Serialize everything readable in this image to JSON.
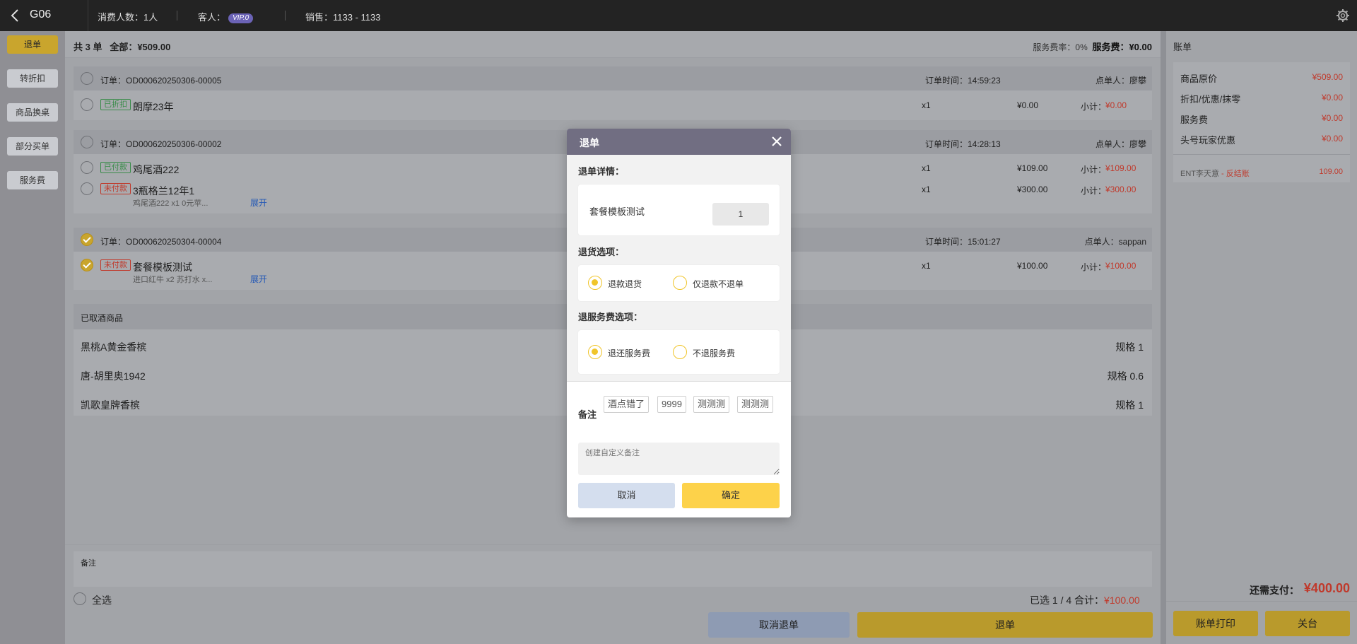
{
  "topbar": {
    "table_no": "G06",
    "consumers": "消费人数：1人",
    "guest_label": "客人：",
    "vip": "VIP.0",
    "sales": "销售：1133 - 1133"
  },
  "sidebar": {
    "items": [
      {
        "label": "退单"
      },
      {
        "label": "转折扣"
      },
      {
        "label": "商品换桌"
      },
      {
        "label": "部分买单"
      },
      {
        "label": "服务费"
      }
    ]
  },
  "summary": {
    "count": "共 3 单",
    "total_label": "全部：",
    "total": "¥509.00",
    "service_rate": "服务费率：0%",
    "service_fee_label": "服务费：",
    "service_fee": "¥0.00"
  },
  "orders": [
    {
      "id": "订单：OD000620250306-00005",
      "time": "订单时间：14:59:23",
      "waiter": "点单人：廖攀",
      "items": [
        {
          "tag": "已折扣",
          "name": "朗摩23年",
          "qty": "x1",
          "price": "¥0.00",
          "subtotal_label": "小计：",
          "subtotal": "¥0.00"
        }
      ]
    },
    {
      "id": "订单：OD000620250306-00002",
      "time": "订单时间：14:28:13",
      "waiter": "点单人：廖攀",
      "items": [
        {
          "tag": "已付款",
          "name": "鸡尾酒222",
          "qty": "x1",
          "price": "¥109.00",
          "subtotal_label": "小计：",
          "subtotal": "¥109.00"
        },
        {
          "tag": "未付款",
          "name": "3瓶格兰12年1",
          "sub": "鸡尾酒222 x1   0元苹...",
          "expand": "展开",
          "qty": "x1",
          "price": "¥300.00",
          "subtotal_label": "小计：",
          "subtotal": "¥300.00"
        }
      ]
    },
    {
      "id": "订单：OD000620250304-00004",
      "time": "订单时间：15:01:27",
      "waiter": "点单人：sappan",
      "items": [
        {
          "tag": "未付款",
          "name": "套餐模板测试",
          "sub": "进口红牛 x2   苏打水 x...",
          "expand": "展开",
          "qty": "x1",
          "price": "¥100.00",
          "subtotal_label": "小计：",
          "subtotal": "¥100.00"
        }
      ]
    }
  ],
  "cancelled": {
    "title": "已取酒商品",
    "items": [
      {
        "name": "黑桃A黄金香槟",
        "spec": "规格 1"
      },
      {
        "name": "唐-胡里奥1942",
        "spec": "规格 0.6"
      },
      {
        "name": "凯歌皇牌香槟",
        "spec": "规格 1"
      }
    ]
  },
  "bottom": {
    "remark_label": "备注",
    "select_all": "全选",
    "selected": "已选 1 / 4 合计：",
    "selected_total": "¥100.00",
    "cancel_refund": "取消退单",
    "refund": "退单"
  },
  "bill": {
    "title": "账单",
    "rows": [
      {
        "label": "商品原价",
        "value": "¥509.00"
      },
      {
        "label": "折扣/优惠/抹零",
        "value": "¥0.00"
      },
      {
        "label": "服务费",
        "value": "¥0.00"
      },
      {
        "label": "头号玩家优惠",
        "value": "¥0.00"
      }
    ],
    "ent_label": "ENT李天意",
    "ent_status": " - 反结账",
    "ent_value": "109.00",
    "need_pay_label": "还需支付：",
    "need_pay": "¥400.00",
    "print": "账单打印",
    "close_table": "关台"
  },
  "modal": {
    "title": "退单",
    "detail_label": "退单详情：",
    "item_name": "套餐模板测试",
    "qty": "1",
    "return_label": "退货选项：",
    "return_opt1": "退款退货",
    "return_opt2": "仅退款不退单",
    "service_label": "退服务费选项：",
    "service_opt1": "退还服务费",
    "service_opt2": "不退服务费",
    "remark_label": "备注",
    "chips": [
      "酒点错了",
      "9999",
      "测测测",
      "测测测"
    ],
    "custom_placeholder": "创建自定义备注",
    "cancel": "取消",
    "confirm": "确定"
  },
  "colors": {
    "accent": "#f0c52a",
    "price_red": "#c0392b",
    "modal_header": "#716e82"
  }
}
